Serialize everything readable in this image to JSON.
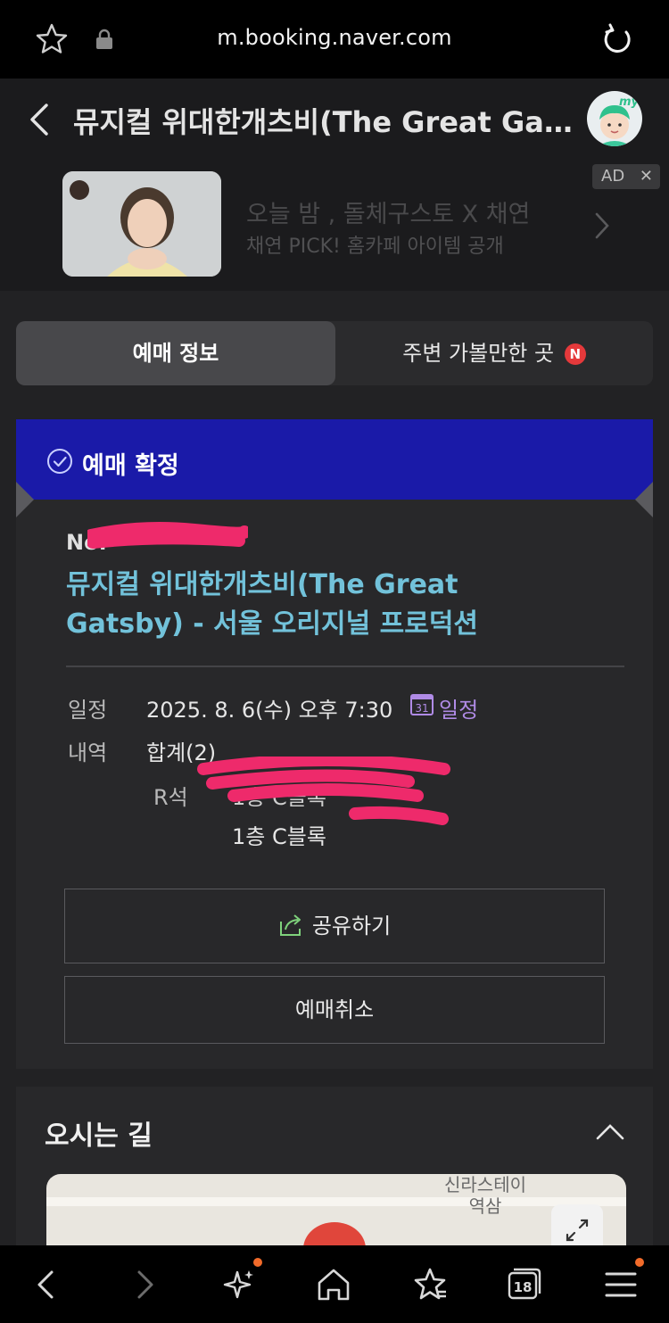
{
  "browser": {
    "url": "m.booking.naver.com",
    "tab_count": "18"
  },
  "header": {
    "title": "뮤지컬 위대한개츠비(The Great Gats..."
  },
  "ad": {
    "line1": "오늘 밤 , 돌체구스토 X 채연",
    "line2": "채연 PICK! 홈카페 아이템 공개",
    "badge": "AD",
    "close": "✕"
  },
  "tabs": {
    "active": "예매 정보",
    "other": "주변 가볼만한 곳",
    "other_badge": "N"
  },
  "ticket": {
    "status": "예매 확정",
    "number_prefix": "No.",
    "show_title": "뮤지컬 위대한개츠비(The Great Gatsby) - 서울 오리지널 프로덕션",
    "date_label": "일정",
    "date_value": "2025. 8. 6(수) 오후 7:30",
    "calendar_day": "31",
    "calendar_link": "일정",
    "detail_label": "내역",
    "detail_value": "합계(2)",
    "seat_grade": "R석",
    "seat_line1": "1층 C블록",
    "seat_line2": "1층 C블록",
    "share_button": "공유하기",
    "cancel_button": "예매취소"
  },
  "directions": {
    "heading": "오시는 길",
    "map_label": "신라스테이\n역삼"
  },
  "colors": {
    "banner_blue": "#1a1aa8",
    "title_cyan": "#72c2da",
    "calendar_purple": "#b08be6",
    "redaction_pink": "#ee2a6b"
  }
}
